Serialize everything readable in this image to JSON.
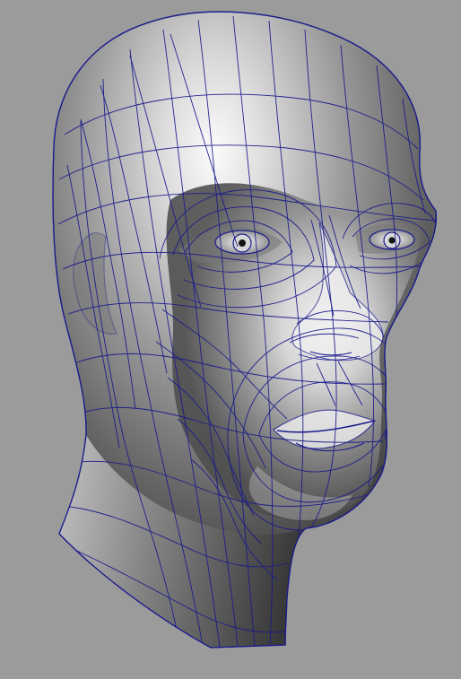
{
  "viewport": {
    "background": "#9b9b9b",
    "wire_color": "#1a1a8c",
    "shade_dark": "#2f2f2f",
    "shade_mid": "#8a8a8a",
    "shade_light": "#f2f2f2"
  },
  "model": {
    "type": "3d-head-mesh",
    "display_mode": "smooth-shaded-with-wireframe",
    "icon": "head-mesh-icon"
  }
}
